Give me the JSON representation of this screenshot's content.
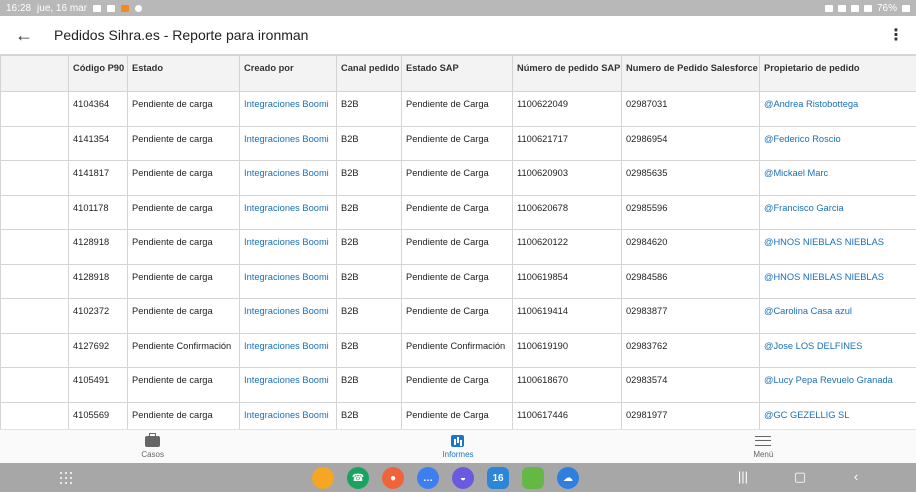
{
  "status_bar": {
    "time": "16:28",
    "date": "jue, 16 mar",
    "battery": "76%"
  },
  "app_bar": {
    "title": "Pedidos Sihra.es - Reporte para ironman"
  },
  "table": {
    "headers": [
      "Código P90",
      "Estado",
      "Creado por",
      "Canal pedido",
      "Estado SAP",
      "Número de pedido SAP",
      "Numero de Pedido Salesforce",
      "Propietario de pedido"
    ],
    "rows": [
      {
        "codigo": "4104364",
        "estado": "Pendiente de carga",
        "creado": "Integraciones Boomi",
        "canal": "B2B",
        "estado_sap": "Pendiente de Carga",
        "num_sap": "1100622049",
        "num_sf": "02987031",
        "propietario": "@Andrea Ristobottega"
      },
      {
        "codigo": "4141354",
        "estado": "Pendiente de carga",
        "creado": "Integraciones Boomi",
        "canal": "B2B",
        "estado_sap": "Pendiente de Carga",
        "num_sap": "1100621717",
        "num_sf": "02986954",
        "propietario": "@Federico Roscio"
      },
      {
        "codigo": "4141817",
        "estado": "Pendiente de carga",
        "creado": "Integraciones Boomi",
        "canal": "B2B",
        "estado_sap": "Pendiente de Carga",
        "num_sap": "1100620903",
        "num_sf": "02985635",
        "propietario": "@Mickael Marc"
      },
      {
        "codigo": "4101178",
        "estado": "Pendiente de carga",
        "creado": "Integraciones Boomi",
        "canal": "B2B",
        "estado_sap": "Pendiente de Carga",
        "num_sap": "1100620678",
        "num_sf": "02985596",
        "propietario": "@Francisco Garcia"
      },
      {
        "codigo": "4128918",
        "estado": "Pendiente de carga",
        "creado": "Integraciones Boomi",
        "canal": "B2B",
        "estado_sap": "Pendiente de Carga",
        "num_sap": "1100620122",
        "num_sf": "02984620",
        "propietario": "@HNOS NIEBLAS NIEBLAS"
      },
      {
        "codigo": "4128918",
        "estado": "Pendiente de carga",
        "creado": "Integraciones Boomi",
        "canal": "B2B",
        "estado_sap": "Pendiente de Carga",
        "num_sap": "1100619854",
        "num_sf": "02984586",
        "propietario": "@HNOS NIEBLAS NIEBLAS"
      },
      {
        "codigo": "4102372",
        "estado": "Pendiente de carga",
        "creado": "Integraciones Boomi",
        "canal": "B2B",
        "estado_sap": "Pendiente de Carga",
        "num_sap": "1100619414",
        "num_sf": "02983877",
        "propietario": "@Carolina Casa azul"
      },
      {
        "codigo": "4127692",
        "estado": "Pendiente Confirmación",
        "creado": "Integraciones Boomi",
        "canal": "B2B",
        "estado_sap": "Pendiente Confirmación",
        "num_sap": "1100619190",
        "num_sf": "02983762",
        "propietario": "@Jose LOS DELFINES"
      },
      {
        "codigo": "4105491",
        "estado": "Pendiente de carga",
        "creado": "Integraciones Boomi",
        "canal": "B2B",
        "estado_sap": "Pendiente de Carga",
        "num_sap": "1100618670",
        "num_sf": "02983574",
        "propietario": "@Lucy Pepa Revuelo Granada"
      },
      {
        "codigo": "4105569",
        "estado": "Pendiente de carga",
        "creado": "Integraciones Boomi",
        "canal": "B2B",
        "estado_sap": "Pendiente de Carga",
        "num_sap": "1100617446",
        "num_sf": "02981977",
        "propietario": "@GC GEZELLIG SL"
      }
    ]
  },
  "bottom_nav": [
    {
      "label": "Casos",
      "icon": "briefcase-icon",
      "active": false
    },
    {
      "label": "Informes",
      "icon": "report-chart-icon",
      "active": true
    },
    {
      "label": "Menú",
      "icon": "hamburger-menu-icon",
      "active": false
    }
  ],
  "dock_apps": [
    {
      "icon": "files-app-icon",
      "color": "#f5a623"
    },
    {
      "icon": "phone-app-icon",
      "color": "#1aa260"
    },
    {
      "icon": "contacts-app-icon",
      "color": "#f0643c"
    },
    {
      "icon": "messages-app-icon",
      "color": "#3d7ff0"
    },
    {
      "icon": "browser-app-icon",
      "color": "#6a5ae0"
    },
    {
      "icon": "calendar-app-icon",
      "color": "#2a86d8",
      "text": "16"
    },
    {
      "icon": "store-app-icon",
      "color": "#66b844"
    },
    {
      "icon": "cloud-app-icon",
      "color": "#2f7fe0"
    }
  ],
  "colors": {
    "link": "#1a6fb5",
    "active_nav": "#1f74c8",
    "header_bg": "#f3f3f3"
  }
}
